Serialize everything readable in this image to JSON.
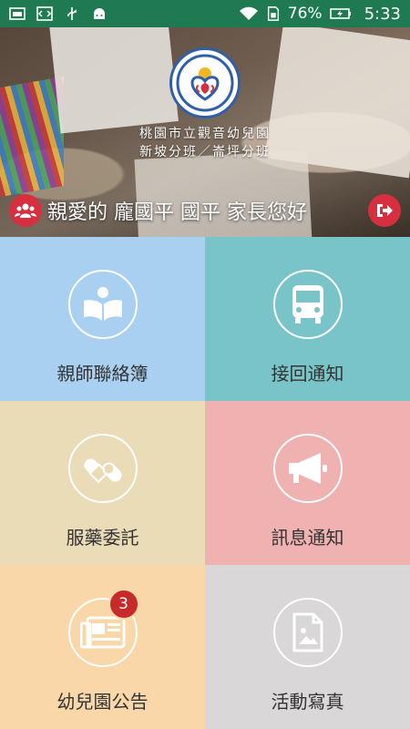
{
  "status_bar": {
    "battery_percent": "76%",
    "time": "5:33"
  },
  "header": {
    "school_name": "桃園市立觀音幼兒園",
    "branch_name": "新坡分班／崙坪分班",
    "greeting": "親愛的 龐國平 國平 家長您好"
  },
  "menu": [
    {
      "label": "親師聯絡簿",
      "icon": "book-icon",
      "color": "#a9d0f0"
    },
    {
      "label": "接回通知",
      "icon": "bus-icon",
      "color": "#79c4c8"
    },
    {
      "label": "服藥委託",
      "icon": "pill-icon",
      "color": "#ebdcb8"
    },
    {
      "label": "訊息通知",
      "icon": "megaphone-icon",
      "color": "#f0b1b1"
    },
    {
      "label": "幼兒園公告",
      "icon": "newspaper-icon",
      "color": "#f9d7a8",
      "badge": "3"
    },
    {
      "label": "活動寫真",
      "icon": "photo-document-icon",
      "color": "#dad7d8"
    }
  ]
}
